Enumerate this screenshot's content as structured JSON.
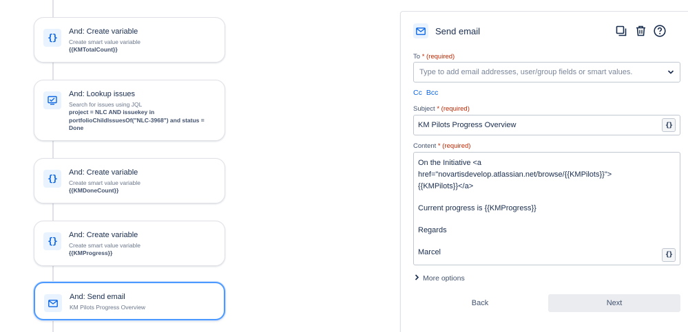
{
  "flow": {
    "cards": [
      {
        "icon": "braces-icon",
        "title": "And: Create variable",
        "desc": "Create smart value variable",
        "detail": "{{KMTotalCount}}"
      },
      {
        "icon": "search-monitor-icon",
        "title": "And: Lookup issues",
        "desc": "Search for issues using JQL",
        "detail": "project = NLC AND issuekey in portfolioChildIssuesOf(\"NLC-3968\") and status = Done"
      },
      {
        "icon": "braces-icon",
        "title": "And: Create variable",
        "desc": "Create smart value variable",
        "detail": "{{KMDoneCount}}"
      },
      {
        "icon": "braces-icon",
        "title": "And: Create variable",
        "desc": "Create smart value variable",
        "detail": "{{KMProgress}}"
      },
      {
        "icon": "mail-icon",
        "title": "And: Send email",
        "desc": "KM Pilots Progress Overview",
        "detail": ""
      }
    ]
  },
  "panel": {
    "title": "Send email",
    "to_label": "To",
    "required": "(required)",
    "to_placeholder": "Type to add email addresses, user/group fields or smart values.",
    "cc": "Cc",
    "bcc": "Bcc",
    "subject_label": "Subject",
    "subject_value": "KM Pilots Progress Overview",
    "content_label": "Content",
    "content_lines": [
      "On the Initiative <a href=\"novartisdevelop.atlassian.net/browse/{{KMPilots}}\">",
      "{{KMPilots}}</a>",
      "Current progress is {{KMProgress}}",
      "Regards",
      "Marcel"
    ],
    "smart_value_btn": "{}",
    "more_options": "More options",
    "back": "Back",
    "next": "Next"
  },
  "colors": {
    "accent": "#0c66e4",
    "required": "#bf2600",
    "active_border": "#4c9aff"
  }
}
